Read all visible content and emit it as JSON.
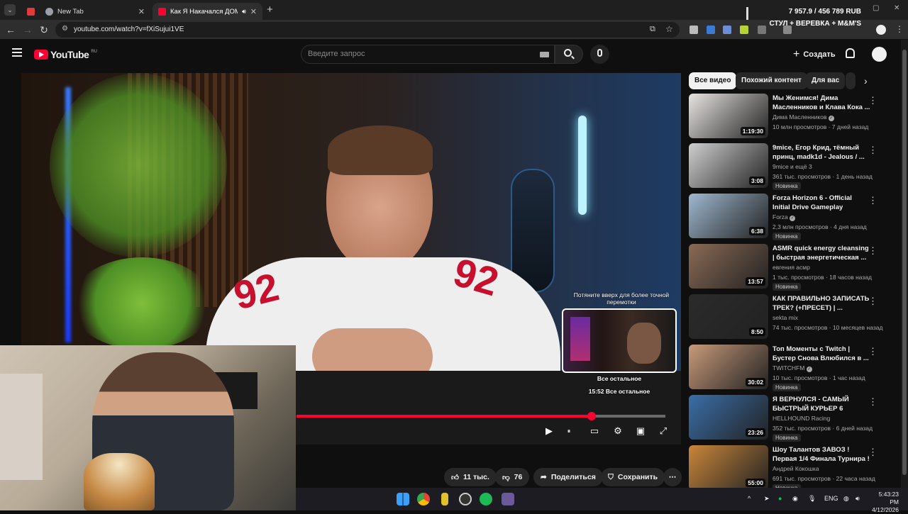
{
  "browser": {
    "tabs": [
      {
        "label": "",
        "favicon_color": "#e03b3b"
      },
      {
        "label": "New Tab",
        "favicon_color": "#9aa0a6"
      },
      {
        "label": "Как Я Накачался ДОМА за...",
        "favicon_color": "#ff0033"
      }
    ],
    "url": "youtube.com/watch?v=fXiSujui1VE",
    "ticker_line1": "7 957.9 / 456 789 RUB",
    "ticker_line2": "СТУЛ + ВЕРЕВКА + M&M'S"
  },
  "youtube": {
    "logo": "YouTube",
    "region": "RU",
    "search_placeholder": "Введите запрос",
    "create_label": "Создать"
  },
  "player": {
    "progress_fraction": 0.8,
    "overlay_hint": "Потяните вверх для более точной перемотки",
    "preview_label": "Все остальное",
    "preview_time": "15:52",
    "preview_chapter": "Все остальное"
  },
  "actions": {
    "likes": "11 тыс.",
    "dislikes": "76",
    "share": "Поделиться",
    "save": "Сохранить"
  },
  "chips": [
    "Все видео",
    "Похожий контент",
    "Для вас"
  ],
  "recommendations": [
    {
      "title": "Мы Женимся! Дима Масленников и Клава Кока ...",
      "channel": "Дима Масленников",
      "verified": true,
      "meta": "10 млн просмотров · 7 дней назад",
      "duration": "1:19:30",
      "badge": "",
      "thumb": "#e8e4e2"
    },
    {
      "title": "9mice, Егор Крид, тёмный принц, madk1d - Jealous / ...",
      "channel": "9mice и ещё 3",
      "verified": false,
      "meta": "361 тыс. просмотров · 1 день назад",
      "duration": "3:08",
      "badge": "Новинка",
      "thumb": "#cfcfcf"
    },
    {
      "title": "Forza Horizon 6 - Official Initial Drive Gameplay",
      "channel": "Forza",
      "verified": true,
      "meta": "2,3 млн просмотров · 4 дня назад",
      "duration": "6:38",
      "badge": "Новинка",
      "thumb": "#9fb8cf"
    },
    {
      "title": "ASMR quick energy cleansing | быстрая энергетическая ...",
      "channel": "евгения асмр",
      "verified": false,
      "meta": "1 тыс. просмотров · 18 часов назад",
      "duration": "13:57",
      "badge": "Новинка",
      "thumb": "#8a6a55"
    },
    {
      "title": "КАК ПРАВИЛЬНО ЗАПИСАТЬ ТРЕК? (+ПРЕСЕТ) | ...",
      "channel": "sekta mix",
      "verified": false,
      "meta": "74 тыс. просмотров · 10 месяцев назад",
      "duration": "8:50",
      "badge": "",
      "thumb": "#2b2b2b"
    },
    {
      "title": "Топ Моменты с Twitch | Бустер Снова Влюбился в ...",
      "channel": "TWITCHFM",
      "verified": true,
      "meta": "10 тыс. просмотров · 1 час назад",
      "duration": "30:02",
      "badge": "Новинка",
      "thumb": "#c89a7a"
    },
    {
      "title": "Я ВЕРНУЛСЯ - САМЫЙ БЫСТРЫЙ КУРЬЕР 6",
      "channel": "HELLHOUND Racing",
      "verified": false,
      "meta": "352 тыс. просмотров · 6 дней назад",
      "duration": "23:26",
      "badge": "Новинка",
      "thumb": "#3a6ea8"
    },
    {
      "title": "Шоу Талантов ЗАВОЗ ! Первая 1/4 Финала Турнира !",
      "channel": "Андрей Кокошка",
      "verified": false,
      "meta": "691 тыс. просмотров · 22 часа назад",
      "duration": "55:00",
      "badge": "Новинка",
      "thumb": "#c9863a"
    }
  ],
  "taskbar": {
    "lang": "ENG",
    "time": "5:43:23 PM",
    "date": "4/12/2026"
  }
}
